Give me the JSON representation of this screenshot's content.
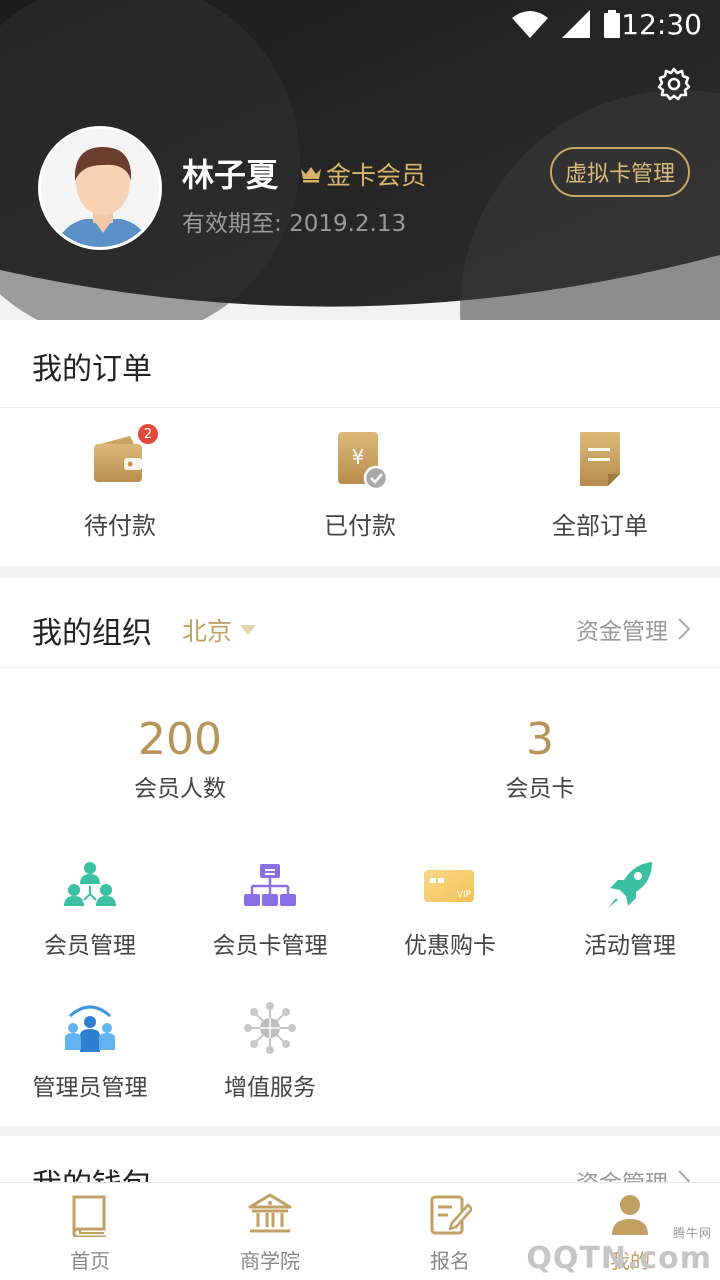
{
  "status": {
    "time": "12:30"
  },
  "profile": {
    "name": "林子夏",
    "tier": "金卡会员",
    "valid_label": "有效期至:",
    "valid_date": "2019.2.13",
    "virtual_card_button": "虚拟卡管理"
  },
  "orders": {
    "title": "我的订单",
    "items": [
      {
        "label": "待付款",
        "badge": "2",
        "icon": "wallet-icon"
      },
      {
        "label": "已付款",
        "icon": "paid-bill-icon"
      },
      {
        "label": "全部订单",
        "icon": "order-list-icon"
      }
    ]
  },
  "organization": {
    "title": "我的组织",
    "city": "北京",
    "fund_link": "资金管理",
    "stats": [
      {
        "value": "200",
        "caption": "会员人数"
      },
      {
        "value": "3",
        "caption": "会员卡"
      }
    ],
    "tools": [
      {
        "label": "会员管理",
        "icon": "members-icon"
      },
      {
        "label": "会员卡管理",
        "icon": "org-chart-icon"
      },
      {
        "label": "优惠购卡",
        "icon": "vip-card-icon"
      },
      {
        "label": "活动管理",
        "icon": "rocket-icon"
      },
      {
        "label": "管理员管理",
        "icon": "admins-icon"
      },
      {
        "label": "增值服务",
        "icon": "network-icon"
      }
    ]
  },
  "wallet": {
    "title": "我的钱包",
    "fund_link": "资金管理"
  },
  "nav": {
    "items": [
      {
        "label": "首页",
        "icon": "book-icon"
      },
      {
        "label": "商学院",
        "icon": "institution-icon"
      },
      {
        "label": "报名",
        "icon": "signup-icon"
      },
      {
        "label": "我的",
        "icon": "person-icon"
      }
    ]
  },
  "watermark": {
    "text": "QQTN.com",
    "sub": "腾牛网"
  },
  "colors": {
    "gold": "#c2a063",
    "dark_header": "#2a2a2a",
    "badge_red": "#e4483a",
    "teal": "#3cc0a4",
    "purple": "#8a6ee6"
  }
}
